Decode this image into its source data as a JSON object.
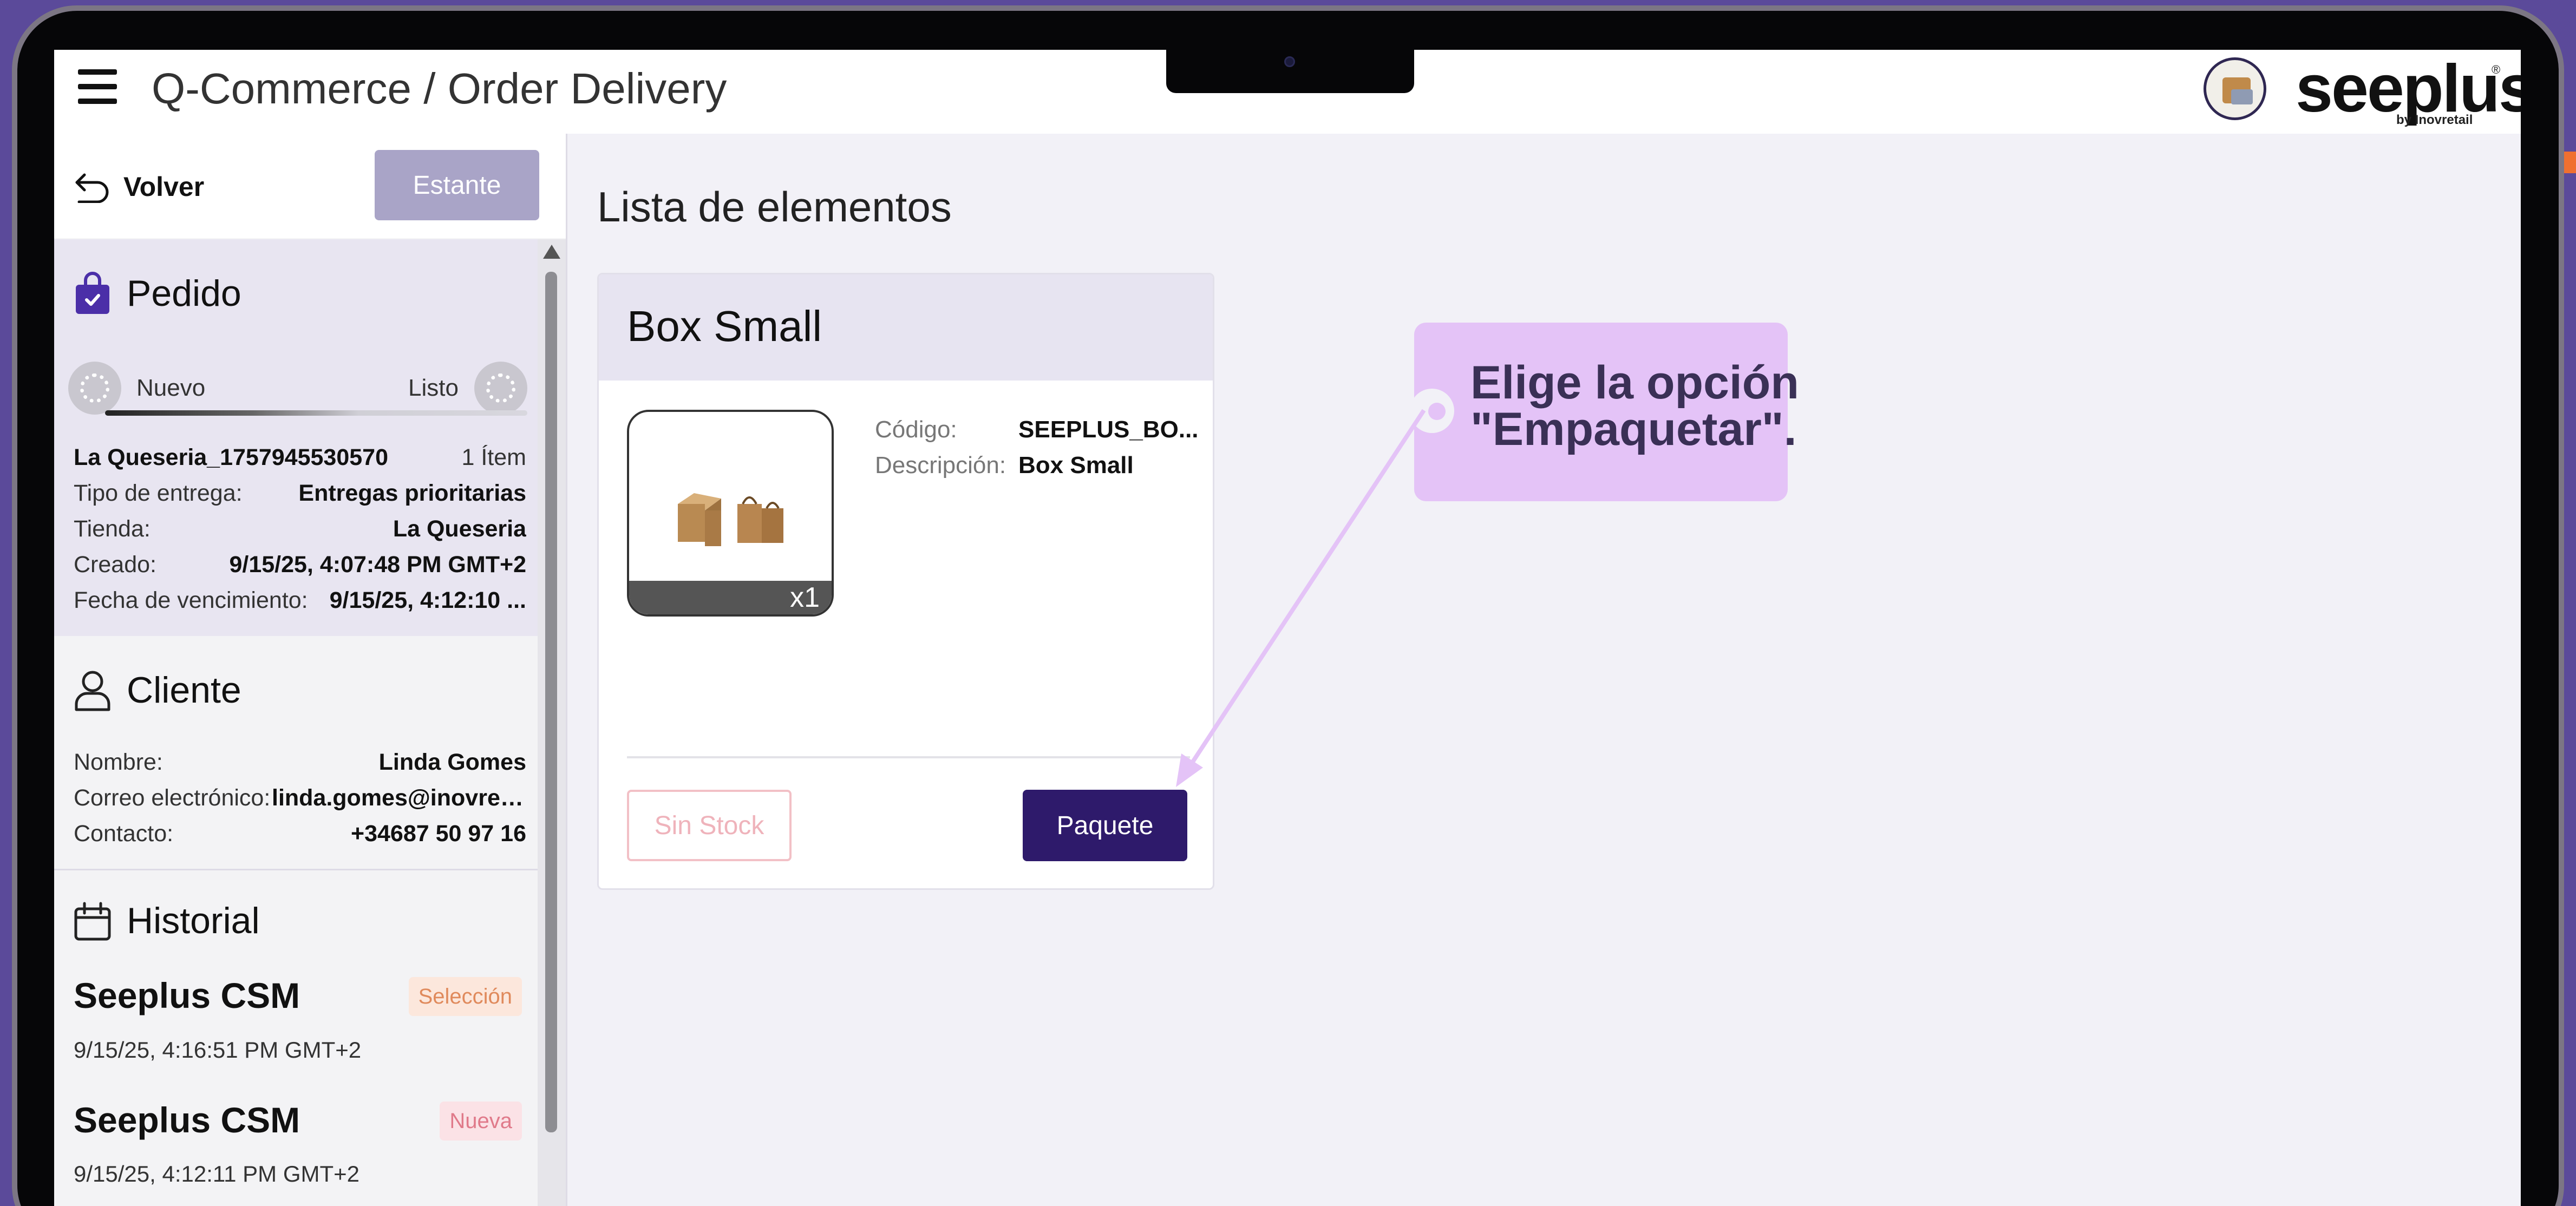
{
  "header": {
    "app_title": "Q-Commerce / Order Delivery",
    "brand_name": "seeplus",
    "brand_sub": "by Inovretail",
    "brand_reg": "®"
  },
  "sidebar": {
    "back_label": "Volver",
    "shelf_label": "Estante",
    "order": {
      "title": "Pedido",
      "status_start": "Nuevo",
      "status_end": "Listo",
      "order_id": "La Queseria_1757945530570",
      "items_count": "1 Ítem",
      "rows": [
        {
          "label": "Tipo de entrega:",
          "value": "Entregas prioritarias"
        },
        {
          "label": "Tienda:",
          "value": "La Queseria"
        },
        {
          "label": "Creado:",
          "value": "9/15/25, 4:07:48 PM GMT+2"
        },
        {
          "label": "Fecha de vencimiento:",
          "value": "9/15/25, 4:12:10 ..."
        }
      ]
    },
    "client": {
      "title": "Cliente",
      "rows": [
        {
          "label": "Nombre:",
          "value": "Linda Gomes"
        },
        {
          "label": "Correo electrónico:",
          "value": "linda.gomes@inovret..."
        },
        {
          "label": "Contacto:",
          "value": "+34687 50 97 16"
        }
      ]
    },
    "history": {
      "title": "Historial",
      "entries": [
        {
          "name": "Seeplus CSM",
          "badge": "Selección",
          "date": "9/15/25, 4:16:51 PM GMT+2"
        },
        {
          "name": "Seeplus CSM",
          "badge": "Nueva",
          "date": "9/15/25, 4:12:11 PM GMT+2"
        }
      ]
    }
  },
  "main": {
    "title": "Lista de elementos",
    "card": {
      "title": "Box Small",
      "qty": "x1",
      "code_label": "Código:",
      "code_value": "SEEPLUS_BO...",
      "desc_label": "Descripción:",
      "desc_value": "Box Small",
      "no_stock_label": "Sin Stock",
      "pack_label": "Paquete"
    }
  },
  "tooltip": {
    "line1": "Elige la opción",
    "line2": "\"Empaquetar\"."
  },
  "colors": {
    "accent": "#2e1a6b",
    "shelf_button": "#a9a4c7",
    "tooltip": "#e4c3f7",
    "frame_background": "#5b4a9a"
  }
}
